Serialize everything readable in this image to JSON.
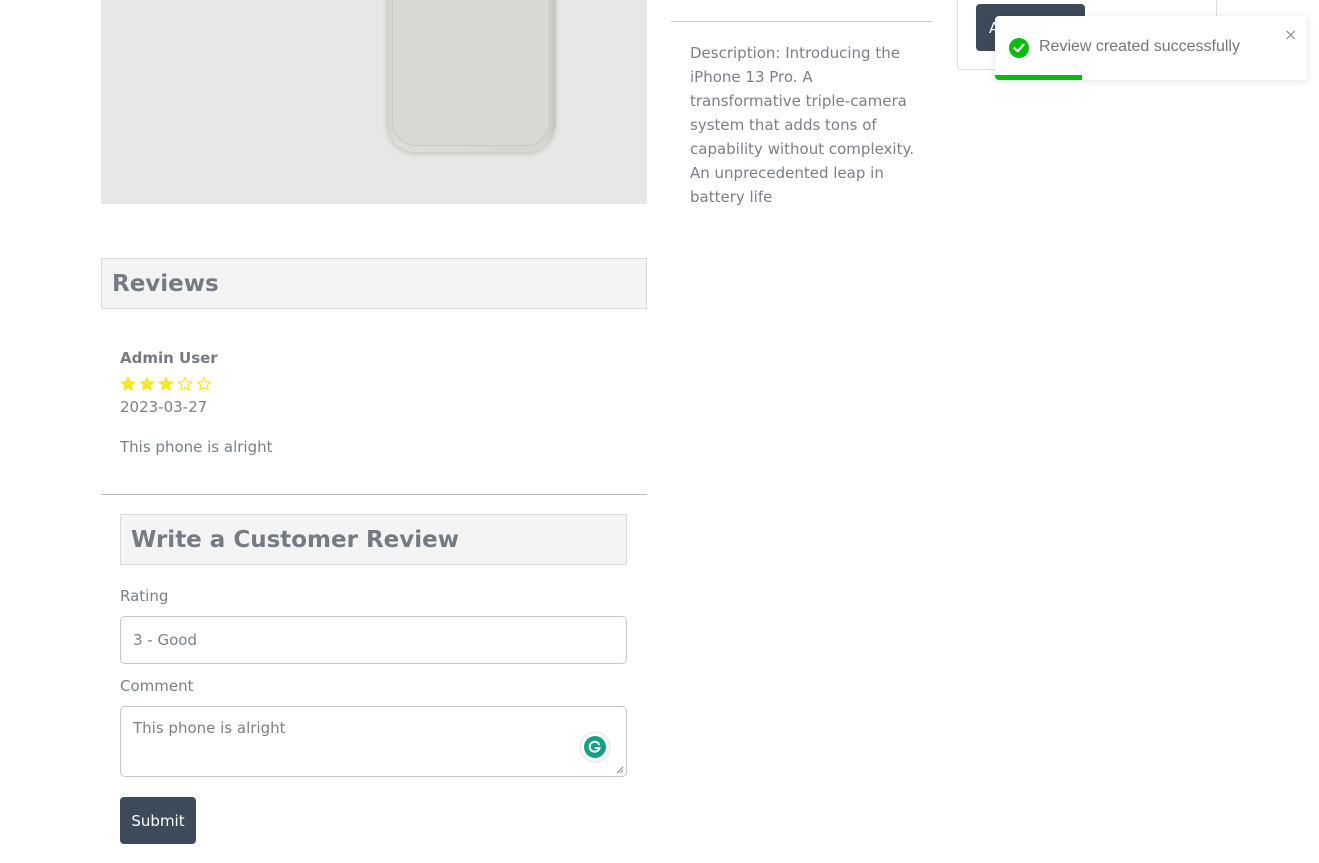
{
  "product": {
    "description": "Description: Introducing the iPhone 13 Pro. A transformative triple-camera system that adds tons of capability without complexity. An unprecedented leap in battery life",
    "add_to_cart_label": "A"
  },
  "toast": {
    "message": "Review created successfully",
    "close_glyph": "×",
    "status": "success",
    "progress": 0.28,
    "icon": "checkmark-circle-icon"
  },
  "reviews": {
    "title": "Reviews",
    "items": [
      {
        "author": "Admin User",
        "rating": 3,
        "max_rating": 5,
        "date": "2023-03-27",
        "comment": "This phone is alright"
      }
    ]
  },
  "review_form": {
    "title": "Write a Customer Review",
    "rating_label": "Rating",
    "rating_value": "3 - Good",
    "comment_label": "Comment",
    "comment_value": "This phone is alright",
    "submit_label": "Submit"
  },
  "colors": {
    "button_bg": "#3d4a5a",
    "star": "#f8e825",
    "toast_success": "#07bc0c",
    "header_bg": "#f4f4f4"
  }
}
